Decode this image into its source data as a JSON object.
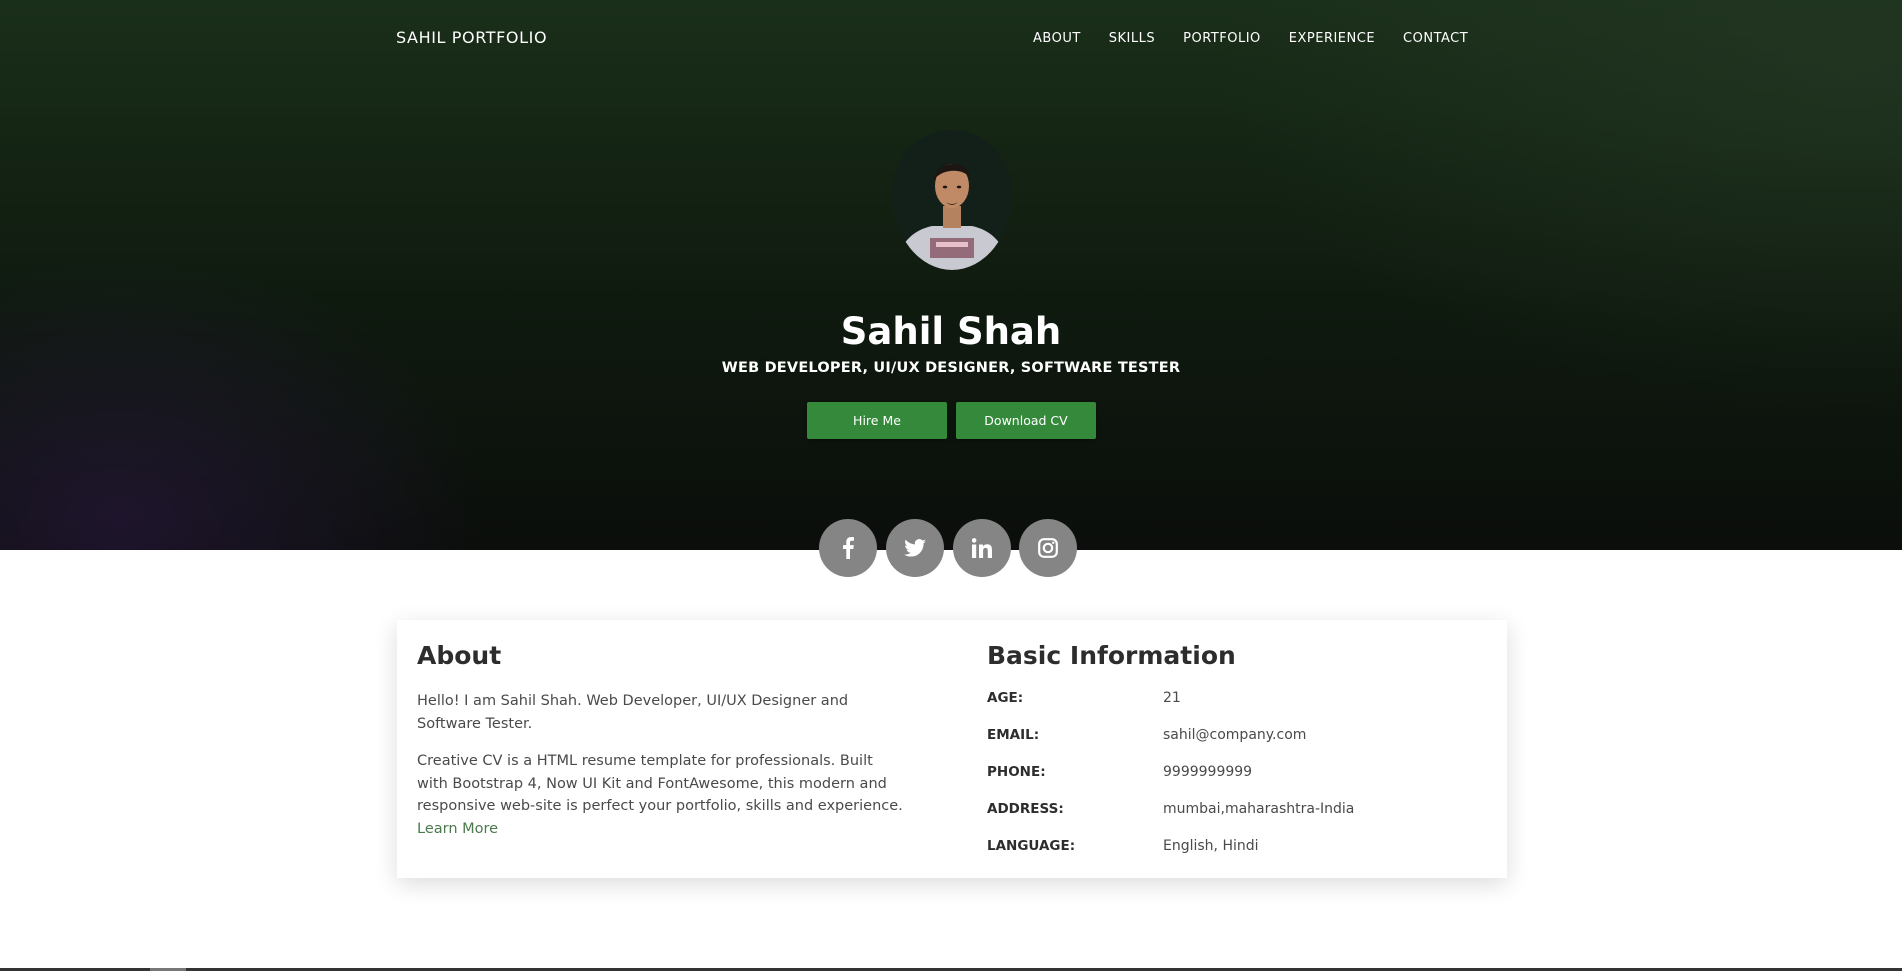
{
  "header": {
    "brand": "SAHIL PORTFOLIO",
    "nav": [
      "ABOUT",
      "SKILLS",
      "PORTFOLIO",
      "EXPERIENCE",
      "CONTACT"
    ]
  },
  "hero": {
    "name": "Sahil Shah",
    "roles": "WEB DEVELOPER, UI/UX DESIGNER, SOFTWARE TESTER",
    "hire_label": "Hire Me",
    "cv_label": "Download CV",
    "socials": [
      "facebook-icon",
      "twitter-icon",
      "linkedin-icon",
      "instagram-icon"
    ]
  },
  "about": {
    "title": "About",
    "p1": "Hello! I am Sahil Shah. Web Developer, UI/UX Designer and Software Tester.",
    "p2": "Creative CV is a HTML resume template for professionals. Built with Bootstrap 4, Now UI Kit and FontAwesome, this modern and responsive web-site is perfect your portfolio, skills and experience.",
    "learn_more": "Learn More"
  },
  "info": {
    "title": "Basic Information",
    "rows": [
      {
        "label": "AGE:",
        "value": "21"
      },
      {
        "label": "EMAIL:",
        "value": "sahil@company.com"
      },
      {
        "label": "PHONE:",
        "value": "9999999999"
      },
      {
        "label": "ADDRESS:",
        "value": "mumbai,maharashtra-India"
      },
      {
        "label": "LANGUAGE:",
        "value": "English, Hindi"
      }
    ]
  },
  "colors": {
    "accent": "#348a3a",
    "link": "#4c7a4c",
    "social_bg": "#858585"
  }
}
